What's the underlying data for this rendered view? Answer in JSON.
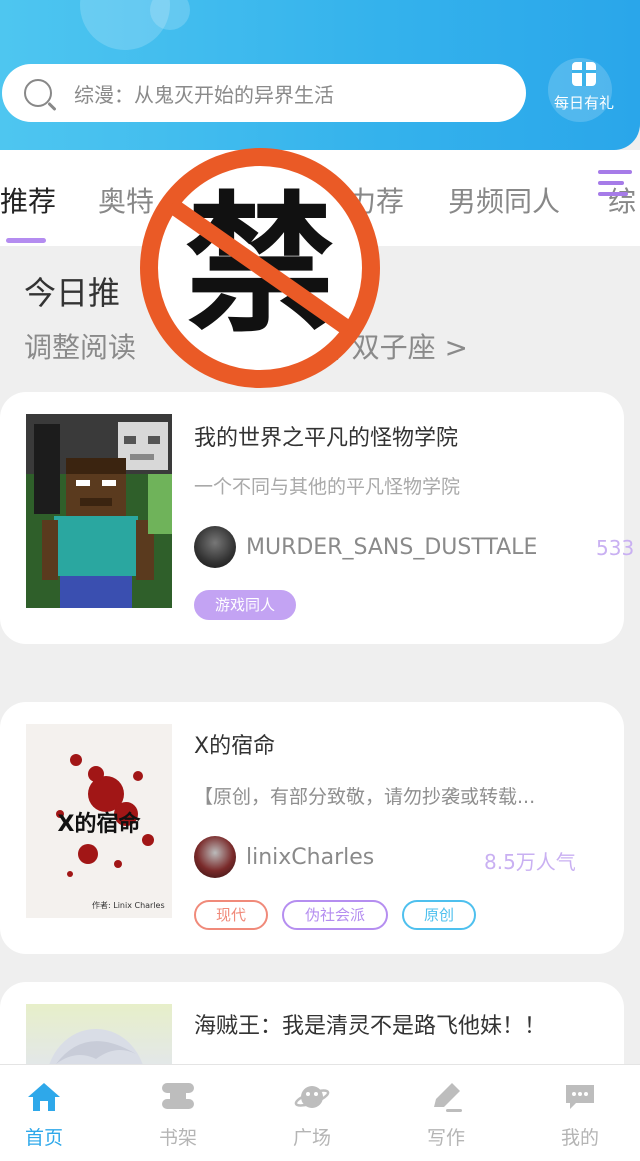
{
  "header": {
    "search_placeholder": "综漫：从鬼灭开始的异界生活",
    "gift_label": "每日有礼"
  },
  "tabs": [
    {
      "label": "推荐",
      "active": true
    },
    {
      "label": "奥特",
      "active": false
    },
    {
      "label": "力荐",
      "active": false
    },
    {
      "label": "男频同人",
      "active": false
    },
    {
      "label": "综",
      "active": false
    }
  ],
  "today": {
    "title": "今日推",
    "subtitle_left": "调整阅读",
    "subtitle_right": "9, 双子座 >"
  },
  "ban_stamp": {
    "char": "禁",
    "color": "#ea5a26"
  },
  "books": [
    {
      "title": "我的世界之平凡的怪物学院",
      "desc": "一个不同与其他的平凡怪物学院",
      "author": "MURDER_SANS_DUSTTALE",
      "popularity": "533",
      "tags": [
        {
          "label": "游戏同人",
          "color": "#b58ef0",
          "style": "filled"
        }
      ]
    },
    {
      "title": "X的宿命",
      "desc": "【原创，有部分致敬，请勿抄袭或转载...",
      "author": "linixCharles",
      "popularity": "8.5万人气",
      "cover_text": "X的宿命",
      "cover_credit": "作者: Linix Charles",
      "tags": [
        {
          "label": "现代",
          "color": "#f08a7a",
          "style": "outline"
        },
        {
          "label": "伪社会派",
          "color": "#b58ef0",
          "style": "outline"
        },
        {
          "label": "原创",
          "color": "#4ec0ee",
          "style": "outline"
        }
      ]
    },
    {
      "title": "海贼王：我是清灵不是路飞他妹！！"
    }
  ],
  "bottom_nav": [
    {
      "label": "首页",
      "icon": "home-icon",
      "active": true
    },
    {
      "label": "书架",
      "icon": "bookshelf-icon",
      "active": false
    },
    {
      "label": "广场",
      "icon": "planet-icon",
      "active": false
    },
    {
      "label": "写作",
      "icon": "pen-icon",
      "active": false
    },
    {
      "label": "我的",
      "icon": "chat-bubble-icon",
      "active": false
    }
  ],
  "colors": {
    "accent": "#2ea8ea",
    "purple": "#b58ef0",
    "header": "#3cb3ea"
  }
}
